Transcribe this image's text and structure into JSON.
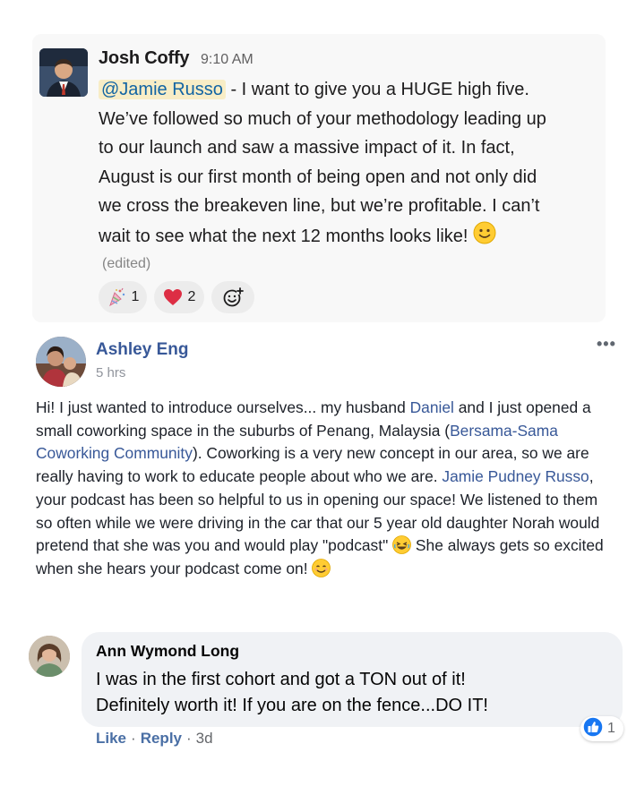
{
  "slack": {
    "author": "Josh Coffy",
    "time": "9:10 AM",
    "mention": "@Jamie Russo",
    "message_lines": [
      " - I want to give you a HUGE high five.",
      "We’ve followed so much of your methodology leading up",
      "to our launch and saw a massive impact of it. In fact,",
      "August is our first month of being open and not only did",
      "we cross the breakeven line, but we’re profitable. I can’t",
      "wait to see what the next 12 months looks like!"
    ],
    "edited_label": "(edited)",
    "reactions": [
      {
        "icon": "confetti-icon",
        "count": "1"
      },
      {
        "icon": "heart-icon",
        "count": "2"
      },
      {
        "icon": "add-reaction-icon",
        "count": ""
      }
    ]
  },
  "facebook_post": {
    "author": "Ashley Eng",
    "time": "5 hrs",
    "more_label": "•••",
    "segments": {
      "s1": "Hi! I just wanted to introduce ourselves... my husband ",
      "link1": "Daniel",
      "s2": " and I just opened a small coworking space in the suburbs of Penang, Malaysia (",
      "link2": "Bersama-Sama Coworking Community",
      "s3": "). Coworking is a very new concept in our area, so we are really having to work to educate people about who we are. ",
      "link3": "Jamie Pudney Russo",
      "s4": ", your podcast has been so helpful to us in opening our space! We listened to them so often while we were driving in the car that our 5 year old daughter Norah would pretend that she was you and would play \"podcast\" ",
      "s5": " She always gets so excited when she hears your podcast come on! "
    }
  },
  "comment": {
    "author": "Ann Wymond Long",
    "text_lines": [
      "I was in the first cohort and got a TON out of it!",
      "Definitely worth it! If you are on the fence...DO IT!"
    ],
    "like_count": "1",
    "like_action": "Like",
    "reply_action": "Reply",
    "separator": "·",
    "age": "3d"
  },
  "colors": {
    "slack_link": "#1264a3",
    "mention_bg": "#f8edc6",
    "fb_link": "#385898",
    "fb_like_blue": "#1877f2"
  }
}
